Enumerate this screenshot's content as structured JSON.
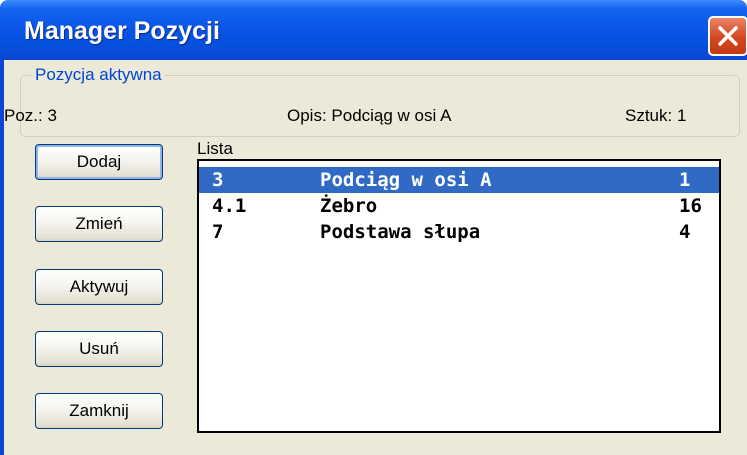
{
  "window": {
    "title": "Manager Pozycji"
  },
  "active_position": {
    "legend": "Pozycja aktywna",
    "poz": "Poz.: 3",
    "opis": "Opis: Podciąg w osi A",
    "sztuk": "Sztuk: 1"
  },
  "buttons": {
    "add": "Dodaj",
    "change": "Zmień",
    "activate": "Aktywuj",
    "delete": "Usuń",
    "close": "Zamknij"
  },
  "list": {
    "label": "Lista",
    "rows": [
      {
        "number": "3",
        "description": "Podciąg w osi A",
        "quantity": "1",
        "selected": true
      },
      {
        "number": "4.1",
        "description": "Żebro",
        "quantity": "16",
        "selected": false
      },
      {
        "number": "7",
        "description": "Podstawa słupa",
        "quantity": "4",
        "selected": false
      }
    ]
  },
  "colors": {
    "title_bar": "#0a56e8",
    "selection": "#316ac5",
    "legend_text": "#0046d5",
    "close_button": "#d3471f"
  },
  "icons": {
    "close": "close-icon"
  }
}
